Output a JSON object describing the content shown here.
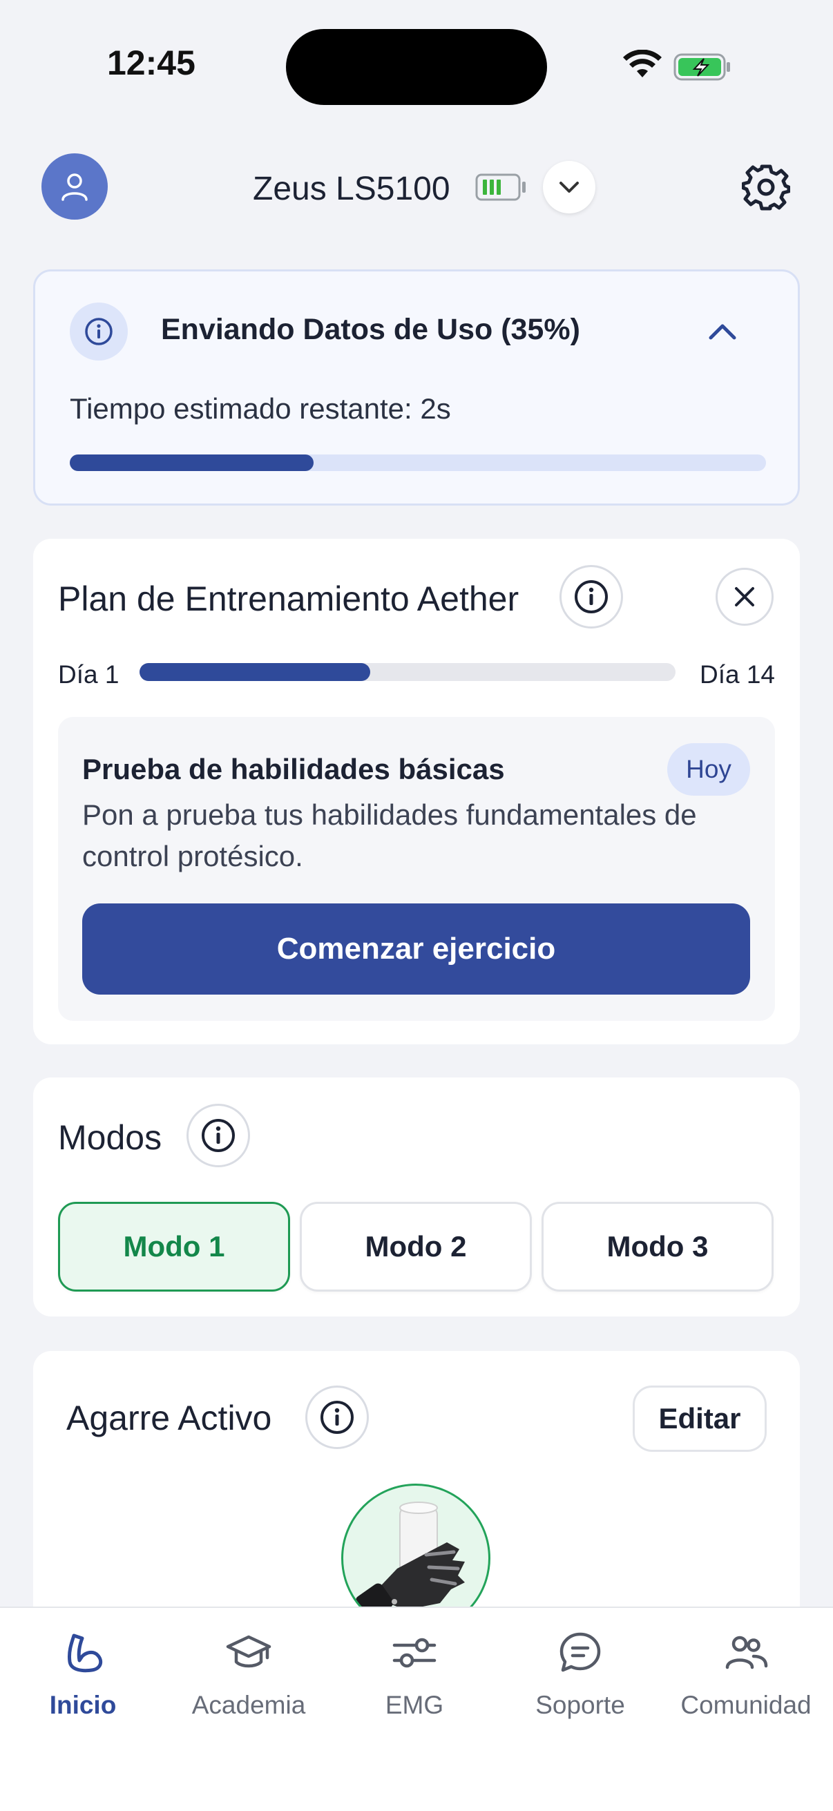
{
  "status_bar": {
    "time": "12:45"
  },
  "header": {
    "device_name": "Zeus LS5100"
  },
  "upload": {
    "title": "Enviando Datos de Uso (35%)",
    "eta": "Tiempo estimado restante: 2s",
    "progress_percent": 35
  },
  "training": {
    "title": "Plan de Entrenamiento Aether",
    "day_start": "Día 1",
    "day_end": "Día 14",
    "progress_fraction": 0.43,
    "task": {
      "title": "Prueba de habilidades básicas",
      "badge": "Hoy",
      "description": "Pon a prueba tus habilidades fundamentales de control protésico.",
      "button": "Comenzar ejercicio"
    }
  },
  "modes": {
    "title": "Modos",
    "items": [
      {
        "label": "Modo 1",
        "active": true
      },
      {
        "label": "Modo 2",
        "active": false
      },
      {
        "label": "Modo 3",
        "active": false
      }
    ]
  },
  "grip": {
    "title": "Agarre Activo",
    "edit_label": "Editar"
  },
  "nav": {
    "items": [
      {
        "label": "Inicio",
        "icon": "arm-icon",
        "active": true
      },
      {
        "label": "Academia",
        "icon": "graduation-cap-icon",
        "active": false
      },
      {
        "label": "EMG",
        "icon": "sliders-icon",
        "active": false
      },
      {
        "label": "Soporte",
        "icon": "chat-icon",
        "active": false
      },
      {
        "label": "Comunidad",
        "icon": "people-icon",
        "active": false
      }
    ]
  },
  "colors": {
    "primary": "#334b9c",
    "success": "#1f9a54",
    "background": "#f2f3f7"
  }
}
